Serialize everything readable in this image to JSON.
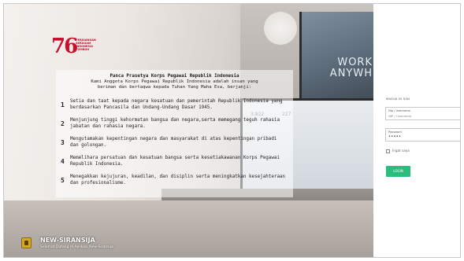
{
  "hero": {
    "background_text": "WORK\nANYWH",
    "logo": {
      "number": "76",
      "subtitle_lines": [
        "PERJUANGAN",
        "SERAGAM",
        "INDONESIA",
        "TUMBUH"
      ]
    },
    "pledge": {
      "title": "Panca Prasetya Korps Pegawai Republik Indonesia",
      "intro_line1": "Kami Anggota Korps Pegawai Republik Indonesia adalah insan yang",
      "intro_line2": "beriman dan bertaqwa kepada Tuhan Yang Maha Esa, berjanji:",
      "items": [
        {
          "n": "1",
          "text": "Setia dan taat kepada negara kesatuan dan pemerintah Republik Indonesia yang berdasarkan Pancasila dan Undang-Undang Dasar 1945."
        },
        {
          "n": "2",
          "text": "Menjunjung tinggi kehormatan bangsa dan negara,serta memegang teguh rahasia jabatan dan rahasia negara."
        },
        {
          "n": "3",
          "text": "Mengutamakan kepentingan negara dan masyarakat di atas kepentingan pribadi dan golongan."
        },
        {
          "n": "4",
          "text": "Memelihara persatuan dan kesatuan bangsa serta kesetiakawanan Korps Pegawai Republik Indonesia."
        },
        {
          "n": "5",
          "text": "Menegakkan kejujuran, keadilan, dan disiplin serta meningkatkan kesejahteraan dan profesionalisme."
        }
      ]
    },
    "brand": {
      "name": "NEW-SIRANSIJA",
      "tagline": "Selamat Datang di Aplikasi New-Siransija"
    }
  },
  "login": {
    "title": "MASUK DI SINI",
    "username": {
      "label": "Nip / Username",
      "value": "NIP / Username"
    },
    "password": {
      "label": "Password",
      "value": "•••••"
    },
    "remember_label": "Ingat saya",
    "submit_label": "LOGIN"
  },
  "colors": {
    "accent": "#2bbd7e",
    "logo_red": "#c8102e"
  }
}
